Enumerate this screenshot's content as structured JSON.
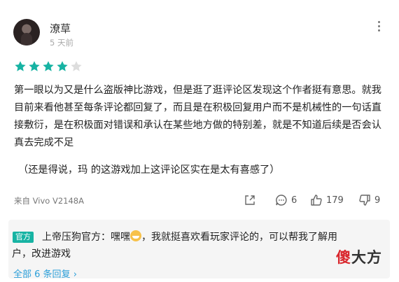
{
  "user": {
    "name": "潦草",
    "time": "5 天前"
  },
  "rating": {
    "stars": 4,
    "max": 5
  },
  "review": {
    "paragraph1": "第一眼以为又是什么盗版神比游戏，但是逛了逛评论区发现这个作者挺有意思。就我目前来看他甚至每条评论都回复了，而且是在积极回复用户而不是机械性的一句话直接敷衍，是在积极面对错误和承认在某些地方做的特别差，就是不知道后续是否会认真去完成不足",
    "paragraph2": "（还是得说，玛 的这游戏加上这评论区实在是太有喜感了）"
  },
  "device": "来自 Vivo V2148A",
  "actions": {
    "comments": "6",
    "likes": "179",
    "dislikes": "9"
  },
  "official_reply": {
    "badge": "官方",
    "author": "上帝压狗官方：",
    "text_part1": "嘿嘿",
    "text_part2": "，我就挺喜欢看玩家评论的，可以帮我了解用",
    "text_line2": "户，改进游戏",
    "all_replies": "全部 6 条回复",
    "all_replies_arrow": "›"
  },
  "watermark": {
    "red": "傻",
    "rest": "大方"
  },
  "colors": {
    "star_on": "#17b3a3",
    "star_off": "#dddddd",
    "badge": "#17b3a3",
    "link": "#2c9fd9"
  }
}
